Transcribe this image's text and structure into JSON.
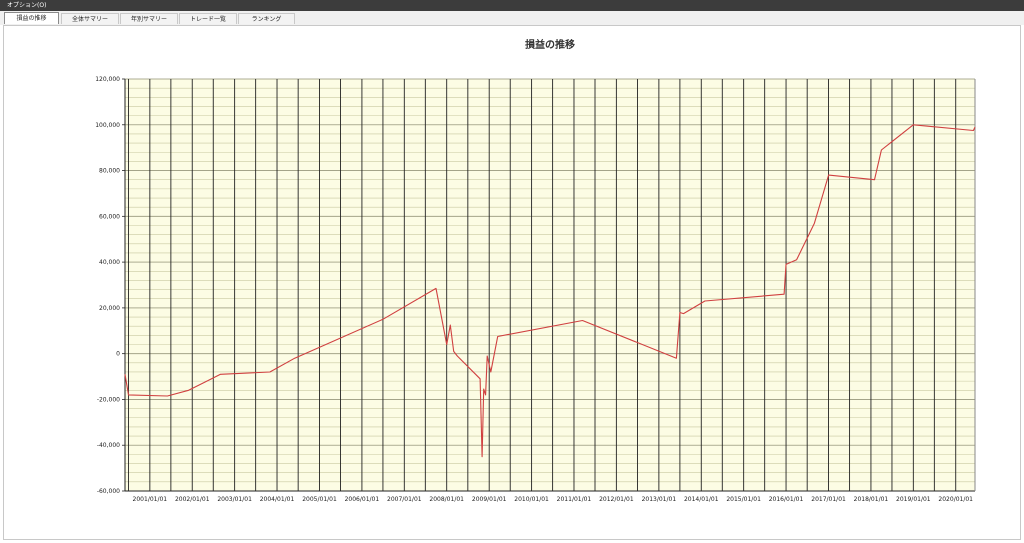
{
  "window": {
    "menu_label": "オプション(O)"
  },
  "tabs": [
    {
      "label": "損益の推移",
      "active": true
    },
    {
      "label": "全体サマリー",
      "active": false
    },
    {
      "label": "年別サマリー",
      "active": false
    },
    {
      "label": "トレード一覧",
      "active": false
    },
    {
      "label": "ランキング",
      "active": false
    }
  ],
  "colors": {
    "plot_background": "#fcfce4",
    "line": "#d04040",
    "grid_major": "#222222",
    "grid_minor": "#c8c8a0"
  },
  "chart_data": {
    "type": "line",
    "title": "損益の推移",
    "xlabel": "",
    "ylabel": "",
    "grid": true,
    "ylim": [
      -60000,
      120000
    ],
    "y_ticks": [
      -60000,
      -40000,
      -20000,
      0,
      20000,
      40000,
      60000,
      80000,
      100000,
      120000
    ],
    "y_tick_labels": [
      "-60,000",
      "-40,000",
      "-20,000",
      "0",
      "20,000",
      "40,000",
      "60,000",
      "80,000",
      "100,000",
      "120,000"
    ],
    "xlim": [
      "2000/06/01",
      "2020/06/15"
    ],
    "x_tick_labels": [
      "2001/01/01",
      "2002/01/01",
      "2003/01/01",
      "2004/01/01",
      "2005/01/01",
      "2006/01/01",
      "2007/01/01",
      "2008/01/01",
      "2009/01/01",
      "2010/01/01",
      "2011/01/01",
      "2012/01/01",
      "2013/01/01",
      "2014/01/01",
      "2015/01/01",
      "2016/01/01",
      "2017/01/01",
      "2018/01/01",
      "2019/01/01",
      "2020/01/01"
    ],
    "series": [
      {
        "x": [
          "2000/06/01",
          "2000/07/01",
          "2001/06/01",
          "2001/12/01",
          "2002/09/01",
          "2003/11/01",
          "2004/06/01",
          "2006/07/01",
          "2007/10/01",
          "2008/01/01",
          "2008/02/01",
          "2008/03/01",
          "2008/04/01",
          "2008/10/15",
          "2008/11/01",
          "2008/11/15",
          "2008/12/01",
          "2008/12/15",
          "2009/01/15",
          "2009/03/15",
          "2011/03/15",
          "2013/06/01",
          "2013/07/01",
          "2013/08/01",
          "2014/02/01",
          "2015/12/15",
          "2016/01/01",
          "2016/04/01",
          "2016/09/01",
          "2017/01/01",
          "2018/02/01",
          "2018/04/01",
          "2019/01/01",
          "2020/06/01",
          "2020/06/15"
        ],
        "y": [
          -9000,
          -18000,
          -18500,
          -16000,
          -9000,
          -8000,
          -2000,
          15000,
          28500,
          4000,
          12500,
          1000,
          -1000,
          -11000,
          -45000,
          -15500,
          -18000,
          -1000,
          -8000,
          7500,
          14500,
          -2000,
          18000,
          17500,
          23000,
          26000,
          39000,
          41000,
          57000,
          78000,
          76000,
          89000,
          100000,
          97500,
          99000
        ]
      }
    ]
  }
}
